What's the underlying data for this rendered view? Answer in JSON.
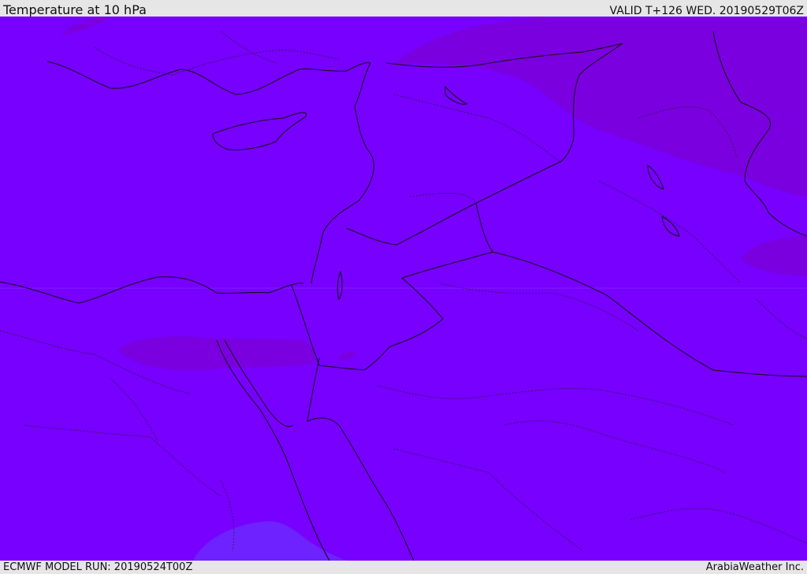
{
  "header": {
    "title": "Temperature at 10 hPa",
    "valid": "VALID T+126 WED. 20190529T06Z"
  },
  "footer": {
    "model_run": "ECMWF MODEL RUN: 20190524T00Z",
    "credit": "ArabiaWeather Inc."
  },
  "colors": {
    "base_field": "#7700ff",
    "warm_field": "#7a00e0",
    "cool_field": "#6d22ff",
    "boundary": "#111111",
    "frame_bg": "#e6e6e6"
  }
}
